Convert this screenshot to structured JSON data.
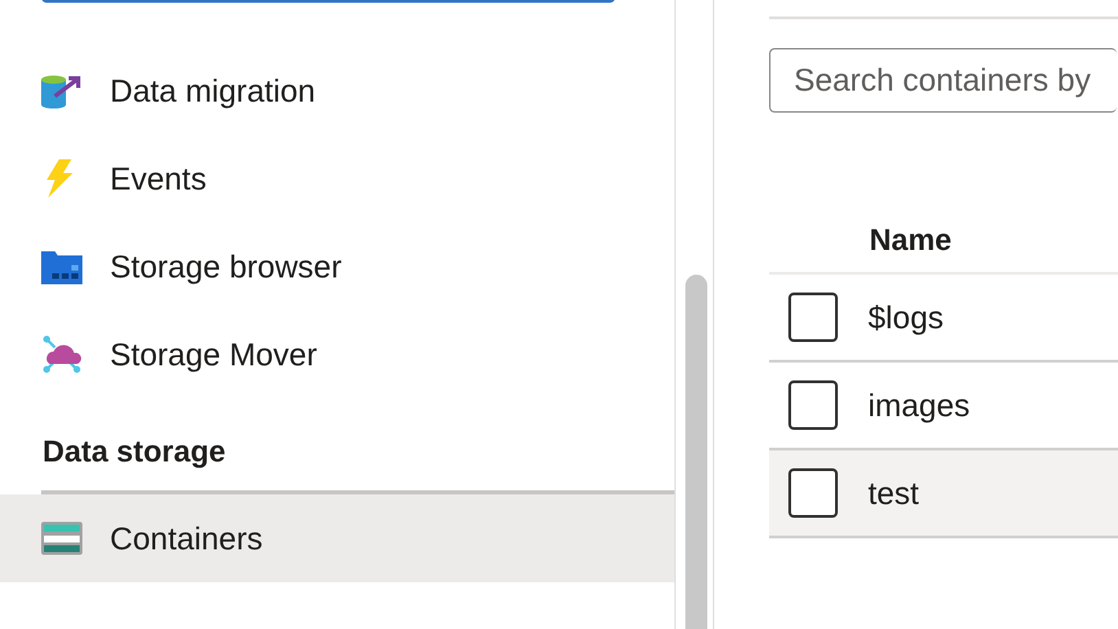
{
  "sidebar": {
    "items": [
      {
        "kind": "item",
        "label": "Data migration",
        "selected": false
      },
      {
        "kind": "item",
        "label": "Events",
        "selected": false
      },
      {
        "kind": "item",
        "label": "Storage browser",
        "selected": false
      },
      {
        "kind": "item",
        "label": "Storage Mover",
        "selected": false
      },
      {
        "kind": "heading",
        "label": "Data storage"
      },
      {
        "kind": "item",
        "label": "Containers",
        "selected": true
      }
    ]
  },
  "search": {
    "placeholder": "Search containers by"
  },
  "table": {
    "columns": [
      "Name"
    ],
    "rows": [
      {
        "name": "$logs",
        "checked": false,
        "highlighted": false
      },
      {
        "name": "images",
        "checked": false,
        "highlighted": false
      },
      {
        "name": "test",
        "checked": false,
        "highlighted": true
      }
    ]
  }
}
